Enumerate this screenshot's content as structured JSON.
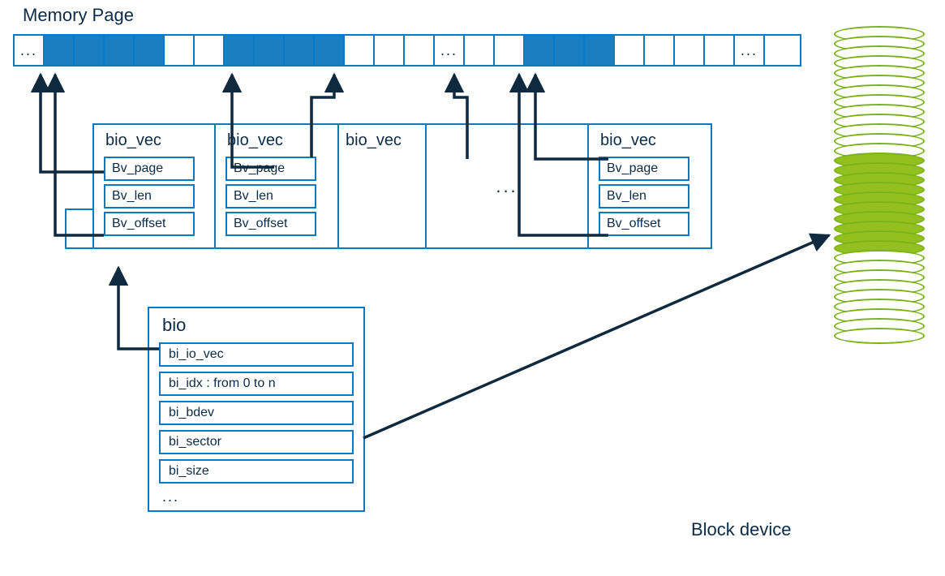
{
  "title": "Memory Page",
  "block_device_label": "Block device",
  "memory_cells": [
    {
      "text": "..."
    },
    {
      "fill": true
    },
    {
      "fill": true
    },
    {
      "fill": true
    },
    {
      "fill": true
    },
    {},
    {},
    {
      "fill": true
    },
    {
      "fill": true
    },
    {
      "fill": true
    },
    {
      "fill": true
    },
    {},
    {},
    {},
    {
      "text": "..."
    },
    {},
    {},
    {
      "fill": true
    },
    {
      "fill": true
    },
    {
      "fill": true
    },
    {},
    {},
    {},
    {},
    {
      "text": "..."
    },
    {}
  ],
  "bio_vec": {
    "label": "bio_vec",
    "fields": [
      "Bv_page",
      "Bv_len",
      "Bv_offset"
    ],
    "ellipsis": "..."
  },
  "bio": {
    "label": "bio",
    "fields": [
      "bi_io_vec",
      "bi_idx :  from 0 to n",
      "bi_bdev",
      "bi_sector",
      "bi_size"
    ],
    "ellipsis": "..."
  },
  "block_device": {
    "total_disks": 32,
    "filled_start": 13,
    "filled_end": 22
  }
}
